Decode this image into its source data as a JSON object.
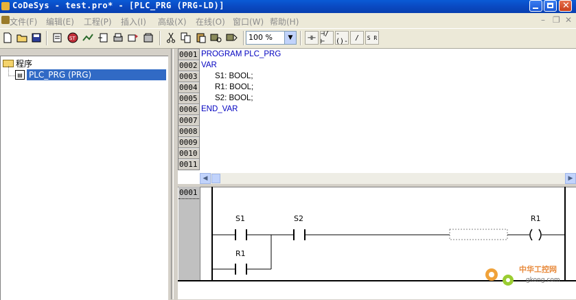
{
  "window": {
    "title": "CoDeSys - test.pro* - [PLC_PRG (PRG-LD)]"
  },
  "menu": {
    "items": [
      "文件(F)",
      "编辑(E)",
      "工程(P)",
      "插入(I)",
      "高级(X)",
      "在线(O)",
      "窗口(W)",
      "帮助(H)"
    ]
  },
  "toolbar": {
    "zoom_value": "100 %",
    "ld_buttons": [
      "⊣⊢",
      "⊣/⊢",
      "-()-",
      "/",
      "S R"
    ]
  },
  "tree": {
    "root_label": "程序",
    "child_label": "PLC_PRG (PRG)"
  },
  "code": {
    "line_numbers": [
      "0001",
      "0002",
      "0003",
      "0004",
      "0005",
      "0006",
      "0007",
      "0008",
      "0009",
      "0010",
      "0011"
    ],
    "lines": [
      "PROGRAM PLC_PRG",
      "VAR",
      "S1: BOOL;",
      "R1: BOOL;",
      "S2: BOOL;",
      "END_VAR"
    ]
  },
  "ladder": {
    "network_number": "0001",
    "contacts": [
      "S1",
      "S2",
      "R1"
    ],
    "coil": "R1"
  },
  "watermark": {
    "cn": "中华工控网",
    "url": "gkong.com"
  }
}
